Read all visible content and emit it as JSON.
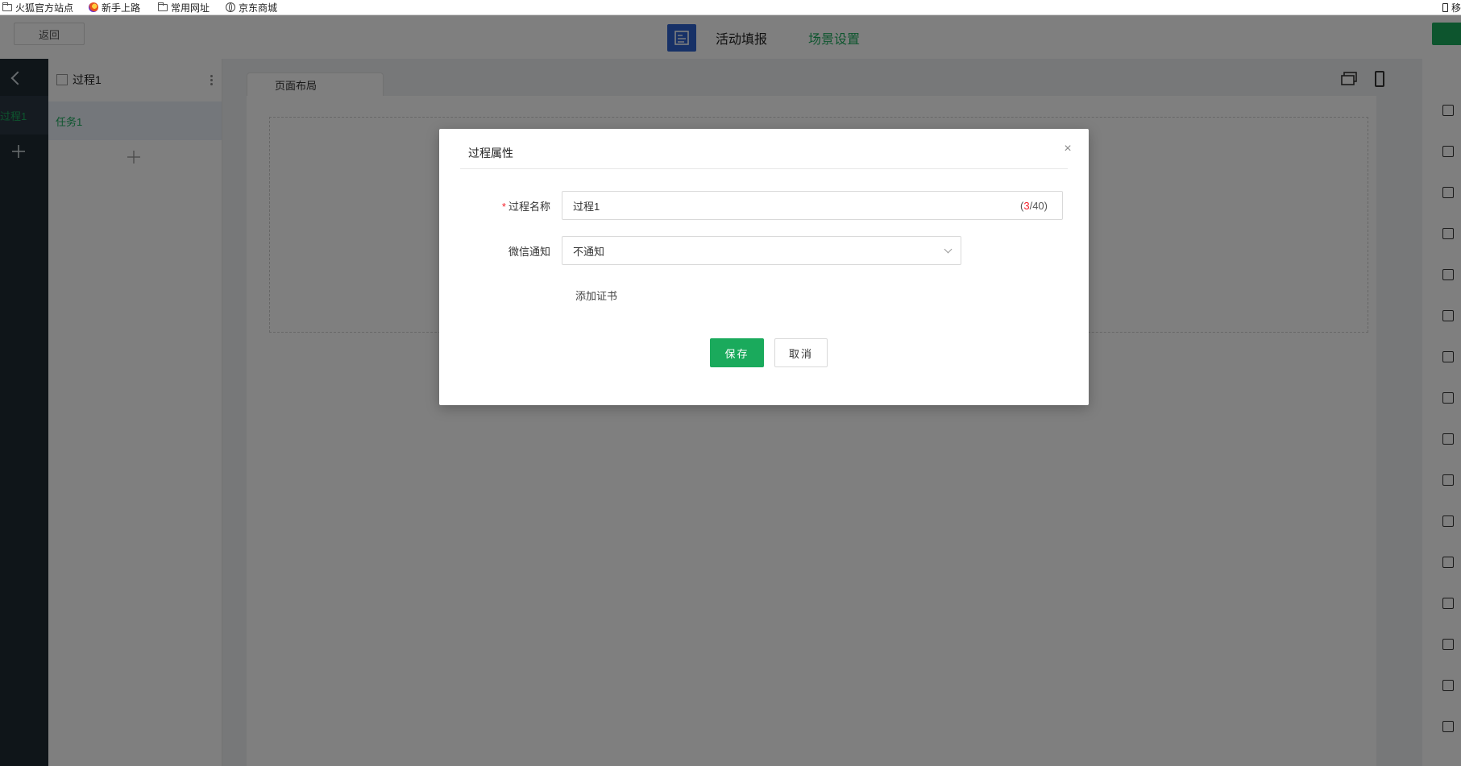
{
  "bookmarks": [
    {
      "label": "火狐官方站点",
      "icon": "folder-icon"
    },
    {
      "label": "新手上路",
      "icon": "firefox-icon"
    },
    {
      "label": "常用网址",
      "icon": "folder-icon"
    },
    {
      "label": "京东商城",
      "icon": "globe-icon"
    }
  ],
  "bookmarks_right_label": "移",
  "header": {
    "back_label": "返回",
    "tabs": [
      {
        "label": "活动填报"
      },
      {
        "label": "场景设置"
      }
    ],
    "accent_color": "#1aaa5c"
  },
  "sidebar": {
    "process_label": "过程1",
    "add_icon": "plus-icon"
  },
  "process_panel": {
    "title": "过程1",
    "task_label": "任务1",
    "add_icon": "plus-icon"
  },
  "canvas": {
    "tab_label": "页面布局",
    "view_icons": [
      "desktop-window-icon",
      "mobile-phone-icon"
    ]
  },
  "component_rail": {
    "icons": [
      "text-icon",
      "rich-text-icon",
      "date-icon",
      "calendar-icon",
      "radio-icon",
      "checkbox-icon",
      "grid-icon",
      "list-icon",
      "edit-icon",
      "person-location-icon",
      "camera-icon",
      "image-edit-icon",
      "photo-icon",
      "mail-icon",
      "id-card-icon",
      "badge-icon"
    ]
  },
  "modal": {
    "title": "过程属性",
    "close_icon": "close-icon",
    "name_label": "过程名称",
    "required_mark": "*",
    "name_value": "过程1",
    "name_count": "3",
    "name_max": "/40)",
    "name_count_prefix": "(",
    "wechat_label": "微信通知",
    "wechat_value": "不通知",
    "add_cert_label": "添加证书",
    "save_label": "保存",
    "cancel_label": "取消"
  }
}
